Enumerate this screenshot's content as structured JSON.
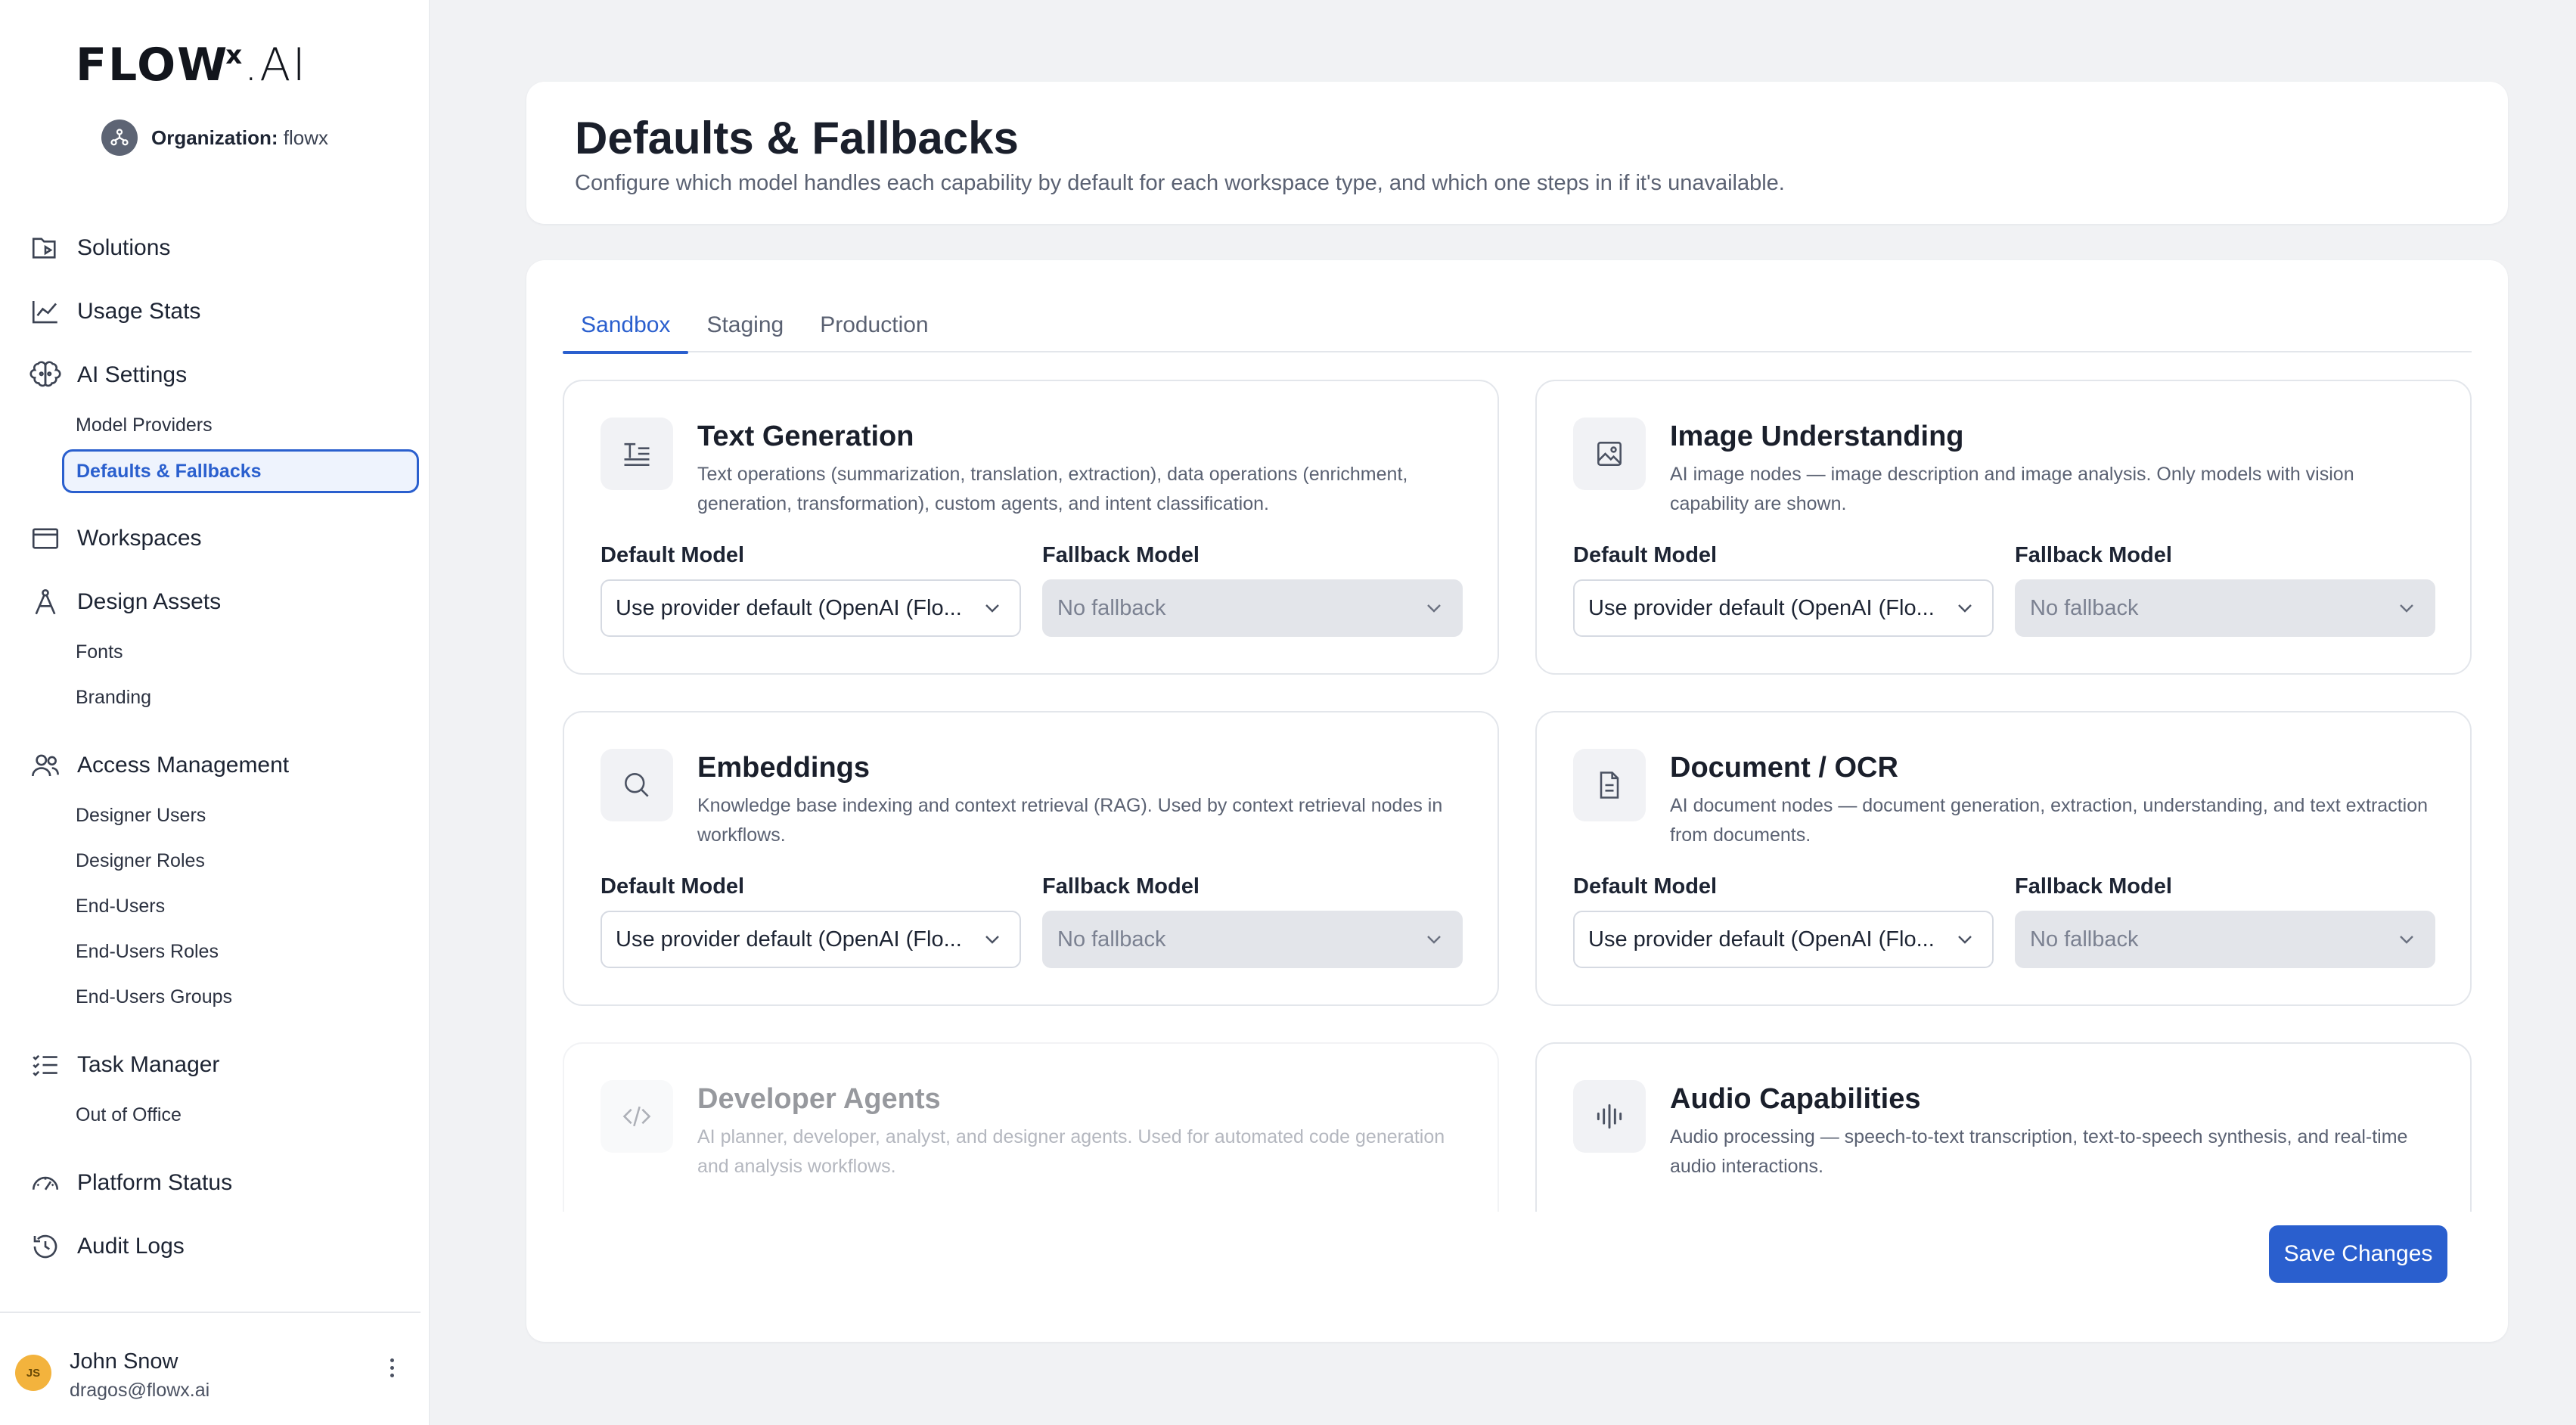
{
  "brand": {
    "logo_main": "FLOW",
    "logo_sup": "x",
    "logo_suffix": ".AI"
  },
  "organization": {
    "label": "Organization:",
    "name": "flowx"
  },
  "sidebar": {
    "items": [
      {
        "label": "Solutions",
        "icon": "solutions-icon"
      },
      {
        "label": "Usage Stats",
        "icon": "chart-line-icon"
      },
      {
        "label": "AI Settings",
        "icon": "brain-icon",
        "children": [
          "Model Providers",
          "Defaults & Fallbacks"
        ]
      },
      {
        "label": "Workspaces",
        "icon": "window-icon"
      },
      {
        "label": "Design Assets",
        "icon": "compass-icon",
        "children": [
          "Fonts",
          "Branding"
        ]
      },
      {
        "label": "Access Management",
        "icon": "users-icon",
        "children": [
          "Designer Users",
          "Designer Roles",
          "End-Users",
          "End-Users Roles",
          "End-Users Groups"
        ]
      },
      {
        "label": "Task Manager",
        "icon": "checklist-icon",
        "children": [
          "Out of Office"
        ]
      },
      {
        "label": "Platform Status",
        "icon": "gauge-icon"
      },
      {
        "label": "Audit Logs",
        "icon": "history-icon"
      }
    ],
    "active_sub": "Defaults & Fallbacks"
  },
  "user": {
    "initials": "JS",
    "name": "John Snow",
    "email": "dragos@flowx.ai",
    "avatar_color": "#f3b33d"
  },
  "header": {
    "title": "Defaults & Fallbacks",
    "subtitle": "Configure which model handles each capability by default for each workspace type, and which one steps in if it's unavailable."
  },
  "tabs": [
    {
      "label": "Sandbox",
      "active": true
    },
    {
      "label": "Staging",
      "active": false
    },
    {
      "label": "Production",
      "active": false
    }
  ],
  "fields": {
    "default_label": "Default Model",
    "fallback_label": "Fallback Model"
  },
  "capabilities": [
    {
      "title": "Text Generation",
      "icon": "text-lines-icon",
      "description": "Text operations (summarization, translation, extraction), data operations (enrichment, generation, transformation), custom agents, and intent classification.",
      "default_model": "Use provider default (OpenAI (Flo...",
      "fallback_model": "No fallback",
      "disabled": false
    },
    {
      "title": "Image Understanding",
      "icon": "image-icon",
      "description": "AI image nodes — image description and image analysis. Only models with vision capability are shown.",
      "default_model": "Use provider default (OpenAI (Flo...",
      "fallback_model": "No fallback",
      "disabled": false
    },
    {
      "title": "Embeddings",
      "icon": "search-icon",
      "description": "Knowledge base indexing and context retrieval (RAG). Used by context retrieval nodes in workflows.",
      "default_model": "Use provider default (OpenAI (Flo...",
      "fallback_model": "No fallback",
      "disabled": false
    },
    {
      "title": "Document / OCR",
      "icon": "document-icon",
      "description": "AI document nodes — document generation, extraction, understanding, and text extraction from documents.",
      "default_model": "Use provider default (OpenAI (Flo...",
      "fallback_model": "No fallback",
      "disabled": false
    },
    {
      "title": "Developer Agents",
      "icon": "code-icon",
      "description": "AI planner, developer, analyst, and designer agents. Used for automated code generation and analysis workflows.",
      "default_model": "",
      "fallback_model": "",
      "disabled": true
    },
    {
      "title": "Audio Capabilities",
      "icon": "waveform-icon",
      "description": "Audio processing — speech-to-text transcription, text-to-speech synthesis, and real-time audio interactions.",
      "default_model": "",
      "fallback_model": "",
      "disabled": false
    }
  ],
  "actions": {
    "save_label": "Save Changes"
  },
  "colors": {
    "accent": "#2a5fce",
    "background": "#f1f2f4",
    "muted_text": "#5a6172"
  }
}
